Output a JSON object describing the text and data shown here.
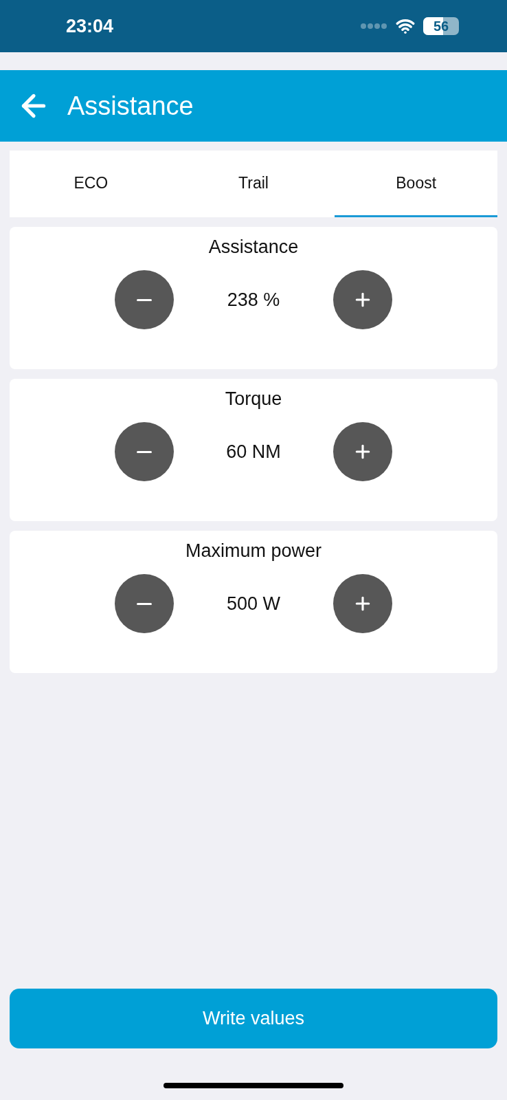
{
  "status_bar": {
    "time": "23:04",
    "battery": "56"
  },
  "header": {
    "title": "Assistance"
  },
  "tabs": [
    {
      "label": "ECO",
      "selected": false
    },
    {
      "label": "Trail",
      "selected": false
    },
    {
      "label": "Boost",
      "selected": true
    }
  ],
  "settings": [
    {
      "label": "Assistance",
      "value": "238 %"
    },
    {
      "label": "Torque",
      "value": "60 NM"
    },
    {
      "label": "Maximum power",
      "value": "500 W"
    }
  ],
  "write_button": "Write values"
}
